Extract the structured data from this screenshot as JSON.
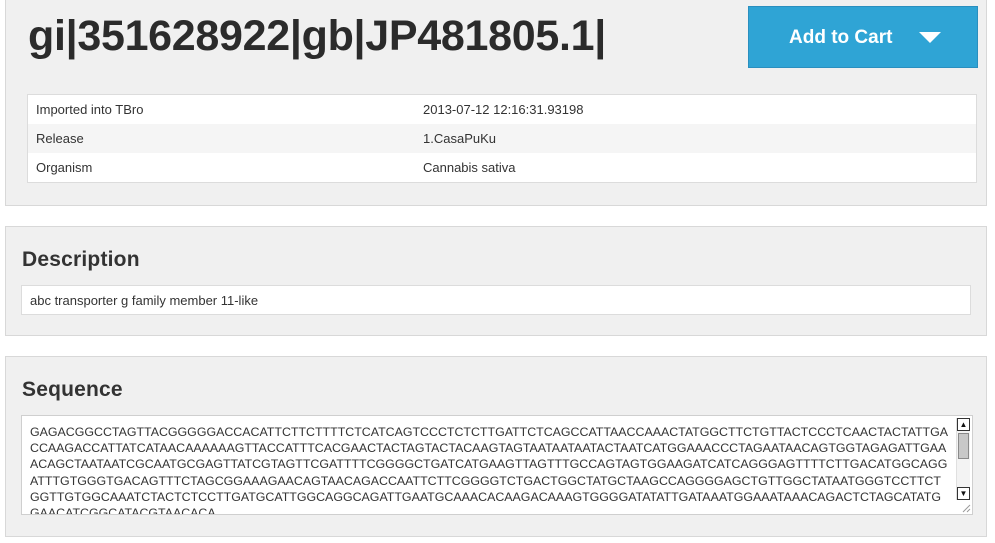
{
  "header": {
    "title": "gi|351628922|gb|JP481805.1|",
    "cart_label": "Add to Cart"
  },
  "info": [
    {
      "label": "Imported into TBro",
      "value": "2013-07-12 12:16:31.93198"
    },
    {
      "label": "Release",
      "value": "1.CasaPuKu"
    },
    {
      "label": "Organism",
      "value": "Cannabis sativa"
    }
  ],
  "description": {
    "heading": "Description",
    "text": "abc transporter g family member 11-like"
  },
  "sequence": {
    "heading": "Sequence",
    "text": "GAGACGGCCTAGTTACGGGGGACCACATTCTTCTTTTCTCATCAGTCCCTCTCTTGATTCTCAGCCATTAACCAAACTATGGCTTCTGTTACTCCCTCAACTACTATTGACCAAGACCATTATCATAACAAAAAAGTTACCATTTCACGAACTACTAGTACTACAAGTAGTAATAATAATACTAATCATGGAAACCCTAGAATAACAGTGGTAGAGATTGAAACAGCTAATAATCGCAATGCGAGTTATCGTAGTTCGATTTTCGGGGCTGATCATGAAGTTAGTTTGCCAGTAGTGGAAGATCATCAGGGAGTTTTCTTGACATGGCAGGATTTGTGGGTGACAGTTTCTAGCGGAAAGAACAGTAACAGACCAATTCTTCGGGGTCTGACTGGCTATGCTAAGCCAGGGGAGCTGTTGGCTATAATGGGTCCTTCTGGTTGTGGCAAATCTACTCTCCTTGATGCATTGGCAGGCAGATTGAATGCAAACACAAGACAAAGTGGGGATATATTGATAAATGGAAATAAACAGACTCTAGCATATGGAACATCGGCATACGTAACACA"
  }
}
